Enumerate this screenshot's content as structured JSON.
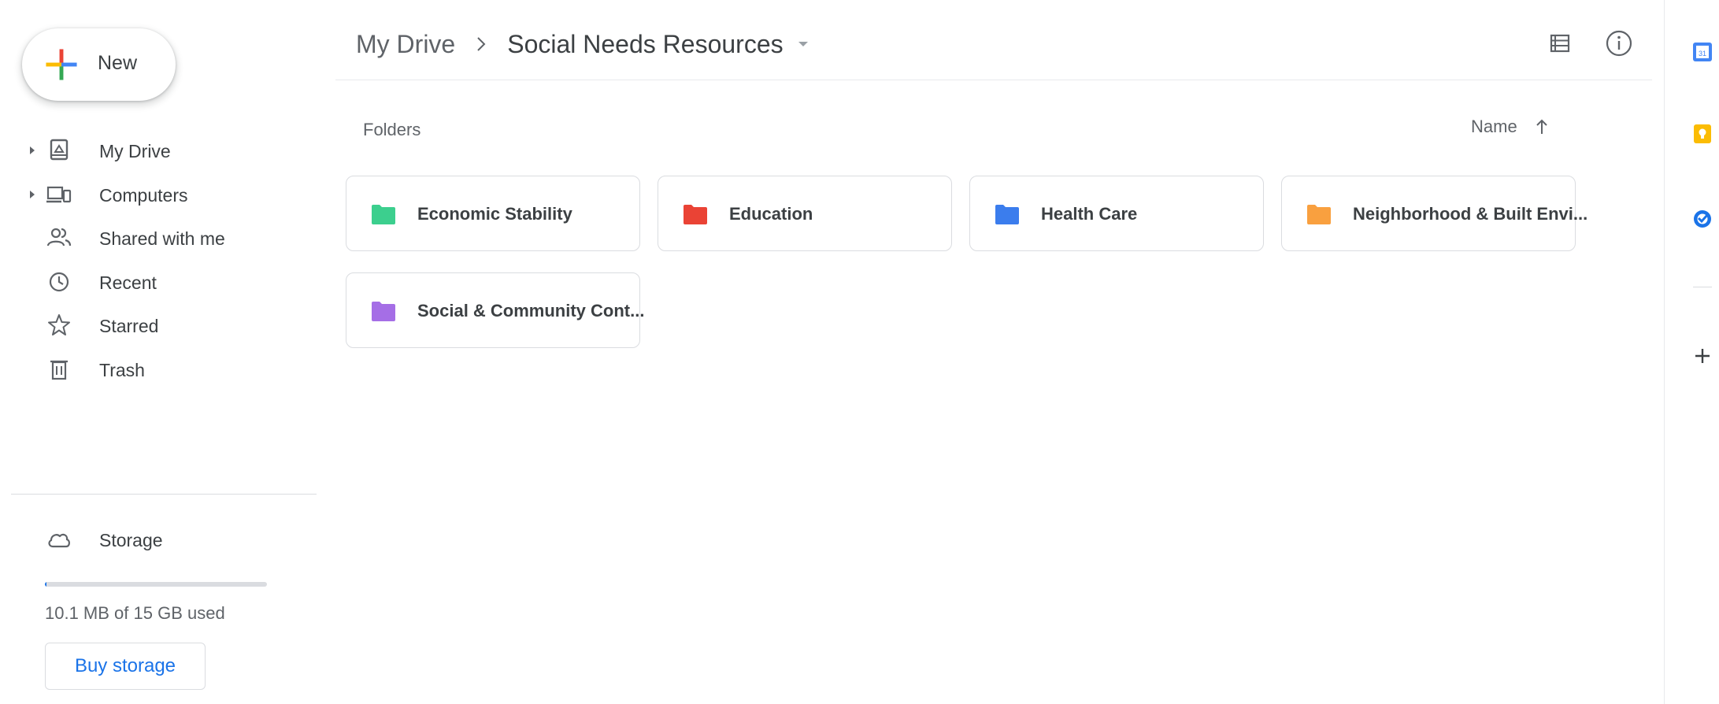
{
  "sidebar": {
    "new_label": "New",
    "items": [
      {
        "label": "My Drive",
        "icon": "my-drive-icon",
        "expandable": true
      },
      {
        "label": "Computers",
        "icon": "computers-icon",
        "expandable": true
      },
      {
        "label": "Shared with me",
        "icon": "shared-with-me-icon",
        "expandable": false
      },
      {
        "label": "Recent",
        "icon": "clock-icon",
        "expandable": false
      },
      {
        "label": "Starred",
        "icon": "star-icon",
        "expandable": false
      },
      {
        "label": "Trash",
        "icon": "trash-icon",
        "expandable": false
      }
    ],
    "storage": {
      "label": "Storage",
      "icon": "cloud-icon",
      "used_text": "10.1 MB of 15 GB used",
      "used_fraction": 0.0007,
      "buy_label": "Buy storage"
    }
  },
  "header": {
    "breadcrumb_root": "My Drive",
    "breadcrumb_current": "Social Needs Resources",
    "actions": [
      "list-view-icon",
      "info-icon"
    ]
  },
  "main": {
    "section_title": "Folders",
    "sort_label": "Name",
    "sort_direction": "ascending",
    "folders": [
      {
        "name": "Economic Stability",
        "color": "#3ccf8e"
      },
      {
        "name": "Education",
        "color": "#ea4335"
      },
      {
        "name": "Health Care",
        "color": "#3b7ded"
      },
      {
        "name": "Neighborhood & Built Envi...",
        "color": "#f9a03f"
      },
      {
        "name": "Social & Community Cont...",
        "color": "#a56ee6"
      }
    ]
  },
  "side_panel": {
    "apps": [
      "calendar-icon",
      "keep-icon",
      "tasks-icon"
    ],
    "add_icon": "plus-icon"
  },
  "colors": {
    "accent": "#1a73e8",
    "text_secondary": "#5f6368"
  }
}
